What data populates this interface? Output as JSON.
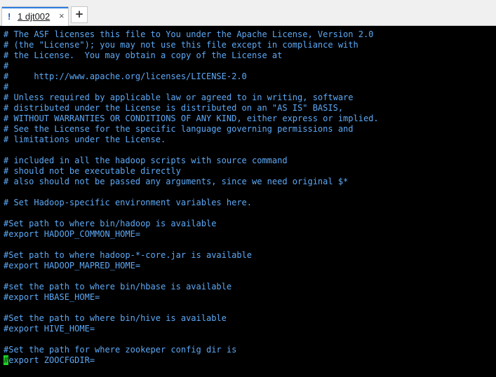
{
  "tabs": [
    {
      "indicator": "!",
      "label": "1 djt002",
      "close": "×"
    }
  ],
  "new_tab_label": "+",
  "colors": {
    "terminal_bg": "#000000",
    "terminal_text": "#5da9f6",
    "cursor": "#1fd42a"
  },
  "terminal": {
    "lines": [
      "# The ASF licenses this file to You under the Apache License, Version 2.0",
      "# (the \"License\"); you may not use this file except in compliance with",
      "# the License.  You may obtain a copy of the License at",
      "#",
      "#     http://www.apache.org/licenses/LICENSE-2.0",
      "#",
      "# Unless required by applicable law or agreed to in writing, software",
      "# distributed under the License is distributed on an \"AS IS\" BASIS,",
      "# WITHOUT WARRANTIES OR CONDITIONS OF ANY KIND, either express or implied.",
      "# See the License for the specific language governing permissions and",
      "# limitations under the License.",
      "",
      "# included in all the hadoop scripts with source command",
      "# should not be executable directly",
      "# also should not be passed any arguments, since we need original $*",
      "",
      "# Set Hadoop-specific environment variables here.",
      "",
      "#Set path to where bin/hadoop is available",
      "#export HADOOP_COMMON_HOME=",
      "",
      "#Set path to where hadoop-*-core.jar is available",
      "#export HADOOP_MAPRED_HOME=",
      "",
      "#set the path to where bin/hbase is available",
      "#export HBASE_HOME=",
      "",
      "#Set the path to where bin/hive is available",
      "#export HIVE_HOME=",
      "",
      "#Set the path for where zookeper config dir is"
    ],
    "cursor_line": {
      "cursor_char": "#",
      "rest": "export ZOOCFGDIR="
    }
  }
}
